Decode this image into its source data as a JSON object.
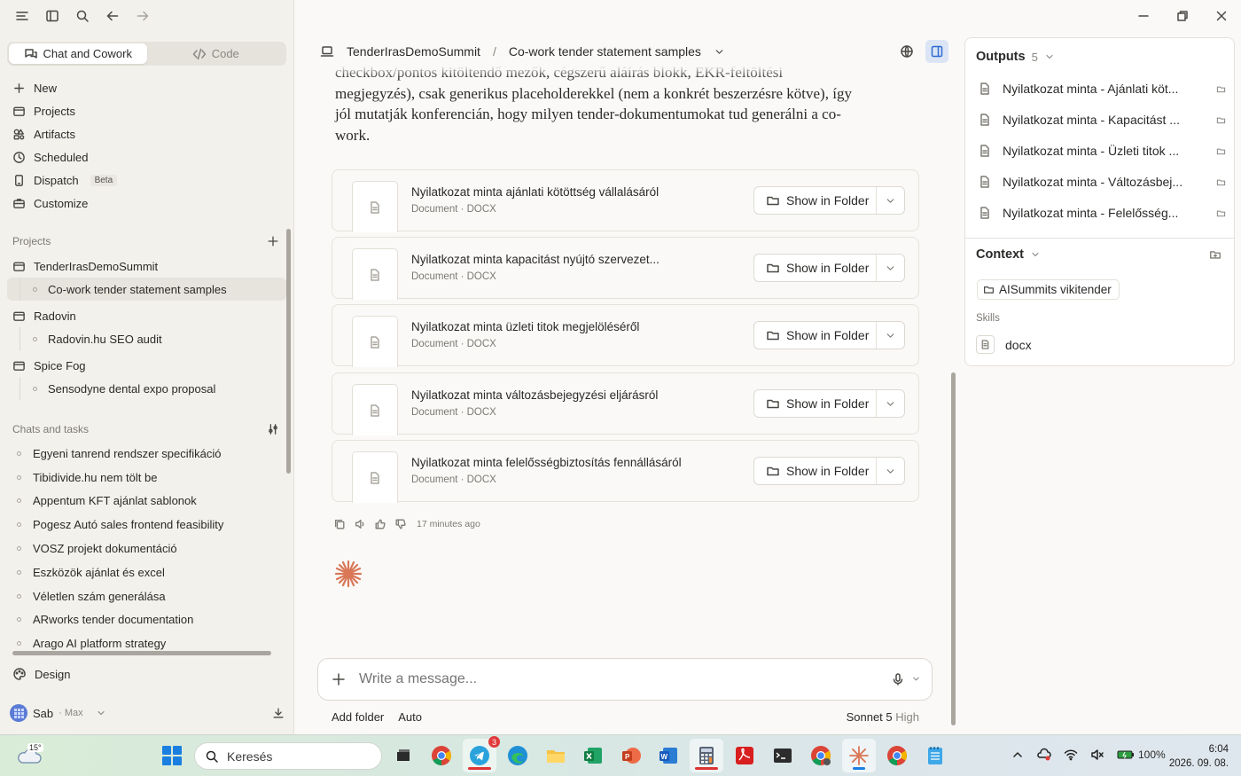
{
  "sidebar": {
    "mode_tabs": [
      {
        "label": "Chat and Cowork",
        "active": true
      },
      {
        "label": "Code",
        "active": false
      }
    ],
    "nav": [
      {
        "label": "New",
        "icon": "plus-icon"
      },
      {
        "label": "Projects",
        "icon": "folder-icon"
      },
      {
        "label": "Artifacts",
        "icon": "shapes-icon"
      },
      {
        "label": "Scheduled",
        "icon": "clock-icon"
      },
      {
        "label": "Dispatch",
        "icon": "phone-icon",
        "badge": "Beta"
      },
      {
        "label": "Customize",
        "icon": "briefcase-icon"
      }
    ],
    "projects_label": "Projects",
    "projects": [
      {
        "name": "TenderIrasDemoSummit",
        "children": [
          "Co-work tender statement samples"
        ]
      },
      {
        "name": "Radovin",
        "children": [
          "Radovin.hu SEO audit"
        ]
      },
      {
        "name": "Spice Fog",
        "children": [
          "Sensodyne dental expo proposal"
        ]
      }
    ],
    "chats_label": "Chats and tasks",
    "chats": [
      "Egyeni tanrend rendszer specifikáció",
      "Tibidivide.hu nem tölt be",
      "Appentum KFT ajánlat sablonok",
      "Pogesz Autó sales frontend feasibility",
      "VOSZ projekt dokumentáció",
      "Eszközök ajánlat és excel",
      "Véletlen szám generálása",
      "ARworks tender documentation",
      "Arago AI platform strategy"
    ],
    "design_label": "Design",
    "user": {
      "name": "Sab",
      "plan": "· Max"
    }
  },
  "main": {
    "breadcrumb": {
      "project": "TenderIrasDemoSummit",
      "separator": "/",
      "chat": "Co-work tender statement samples"
    },
    "message_lines": [
      "checkbox/pontos kitöltendő mezők, cégszerű aláírás blokk, EKR-feltöltési",
      "megjegyzés), csak generikus placeholderekkel (nem a konkrét beszerzésre kötve), így",
      "jól mutatják konferencián, hogy milyen tender-dokumentumokat tud generálni a co-",
      "work."
    ],
    "documents": [
      {
        "title": "Nyilatkozat minta ajánlati kötöttség vállalásáról",
        "meta": "Document · DOCX",
        "button": "Show in Folder"
      },
      {
        "title": "Nyilatkozat minta kapacitást nyújtó szervezet...",
        "meta": "Document · DOCX",
        "button": "Show in Folder"
      },
      {
        "title": "Nyilatkozat minta üzleti titok megjelöléséről",
        "meta": "Document · DOCX",
        "button": "Show in Folder"
      },
      {
        "title": "Nyilatkozat minta változásbejegyzési eljárásról",
        "meta": "Document · DOCX",
        "button": "Show in Folder"
      },
      {
        "title": "Nyilatkozat minta felelősségbiztosítás fennállásáról",
        "meta": "Document · DOCX",
        "button": "Show in Folder"
      }
    ],
    "timestamp": "17 minutes ago",
    "composer": {
      "placeholder": "Write a message..."
    },
    "bottom": {
      "add_folder": "Add folder",
      "auto": "Auto",
      "model": "Sonnet 5",
      "level": "High"
    }
  },
  "right_panel": {
    "outputs_label": "Outputs",
    "outputs_count": "5",
    "outputs": [
      "Nyilatkozat minta - Ajánlati köt...",
      "Nyilatkozat minta - Kapacitást ...",
      "Nyilatkozat minta - Üzleti titok ...",
      "Nyilatkozat minta - Változásbej...",
      "Nyilatkozat minta - Felelősség..."
    ],
    "context_label": "Context",
    "context_folder": "AISummits vikitender",
    "skills_label": "Skills",
    "skill": "docx"
  },
  "taskbar": {
    "temperature": "15°",
    "search_placeholder": "Keresés",
    "telegram_badge": "3",
    "battery": "100%",
    "time": "6:04",
    "date": "2026. 09. 08."
  },
  "colors": {
    "accent": "#d97757",
    "panel_toggle_bg": "#dbe5f5",
    "background": "#faf9f7"
  }
}
